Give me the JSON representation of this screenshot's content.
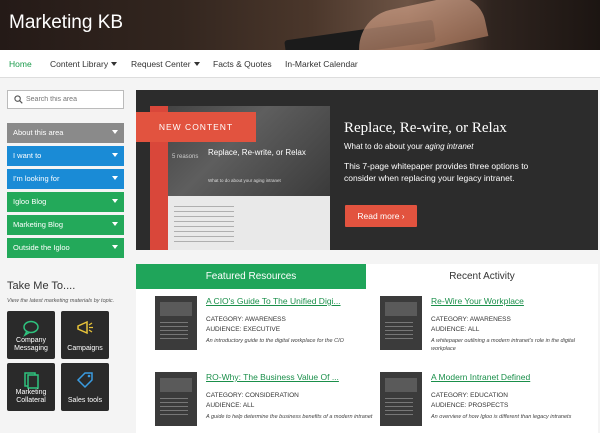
{
  "site": {
    "title": "Marketing KB"
  },
  "nav": {
    "items": [
      {
        "label": "Home",
        "active": true,
        "dropdown": false
      },
      {
        "label": "Content Library",
        "active": false,
        "dropdown": true
      },
      {
        "label": "Request Center",
        "active": false,
        "dropdown": true
      },
      {
        "label": "Facts & Quotes",
        "active": false,
        "dropdown": false
      },
      {
        "label": "In-Market Calendar",
        "active": false,
        "dropdown": false
      }
    ]
  },
  "sidebar": {
    "search_placeholder": "Search this area",
    "items": [
      {
        "label": "About this area",
        "color": "#8a8a8a"
      },
      {
        "label": "I want to",
        "color": "#1a8bd6"
      },
      {
        "label": "I'm looking for",
        "color": "#1a8bd6"
      },
      {
        "label": "Igloo Blog",
        "color": "#23a95a"
      },
      {
        "label": "Marketing Blog",
        "color": "#23a95a"
      },
      {
        "label": "Outside the Igloo",
        "color": "#23a95a"
      }
    ],
    "take_me_title": "Take Me To....",
    "take_me_sub": "View the latest marketing materials by topic.",
    "tiles": [
      {
        "label": "Company Messaging",
        "icon": "speech-bubble-icon"
      },
      {
        "label": "Campaigns",
        "icon": "megaphone-icon"
      },
      {
        "label": "Marketing Collateral",
        "icon": "documents-icon"
      },
      {
        "label": "Sales tools",
        "icon": "tag-icon"
      }
    ]
  },
  "hero": {
    "ribbon": "NEW CONTENT",
    "cover_title": "Replace, Re-write, or Relax",
    "cover_sub": "What to do about your aging intranet",
    "cover_small": "5 reasons",
    "title": "Replace, Re-wire, or Relax",
    "subtitle_prefix": "What to do about your",
    "subtitle_em": "aging intranet",
    "description": "This 7-page whitepaper provides three options to consider when replacing your legacy intranet.",
    "button": "Read more ›"
  },
  "resources": {
    "tabs": [
      "Featured Resources",
      "Recent Activity"
    ],
    "items": [
      {
        "title": "A CIO's Guide To The Unified Digi...",
        "category": "CATEGORY: AWARENESS",
        "audience": "AUDIENCE: EXECUTIVE",
        "description": "An introductory guide to the digital workplace for the CIO"
      },
      {
        "title": "Re-Wire Your Workplace",
        "category": "CATEGORY: AWARENESS",
        "audience": "AUDIENCE: ALL",
        "description": "A whitepaper outlining a modern intranet's role in the digital workplace"
      },
      {
        "title": "RO-Why: The Business Value Of ...",
        "category": "CATEGORY: CONSIDERATION",
        "audience": "AUDIENCE: ALL",
        "description": "A guide to help determine the business benefits of a modern intranet"
      },
      {
        "title": "A Modern Intranet Defined",
        "category": "CATEGORY: EDUCATION",
        "audience": "AUDIENCE: PROSPECTS",
        "description": "An overview of how Igloo is different than legacy intranets"
      }
    ]
  },
  "colors": {
    "accent_green": "#1fa55a",
    "accent_blue": "#1a8bd6",
    "accent_red": "#e2533f",
    "hero_bg": "#2c2c2c"
  }
}
